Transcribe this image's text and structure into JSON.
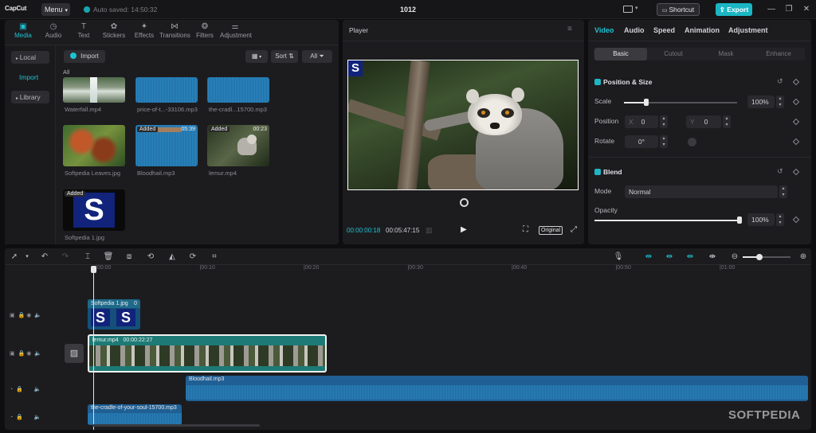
{
  "titlebar": {
    "logo": "CapCut",
    "menu_label": "Menu",
    "autosave": "Auto saved: 14:50:32",
    "project_title": "1012",
    "shortcut_label": "Shortcut",
    "export_label": "Export"
  },
  "media": {
    "tabs": [
      {
        "label": "Media",
        "icon": "media-icon"
      },
      {
        "label": "Audio",
        "icon": "audio-icon"
      },
      {
        "label": "Text",
        "icon": "text-icon"
      },
      {
        "label": "Stickers",
        "icon": "stickers-icon"
      },
      {
        "label": "Effects",
        "icon": "effects-icon"
      },
      {
        "label": "Transitions",
        "icon": "transitions-icon"
      },
      {
        "label": "Filters",
        "icon": "filters-icon"
      },
      {
        "label": "Adjustment",
        "icon": "adjustment-icon"
      }
    ],
    "sidebar": [
      "Local",
      "Import",
      "Library"
    ],
    "import_label": "Import",
    "sort_label": "Sort",
    "all_label": "All",
    "section_all": "All",
    "items": [
      {
        "name": "Waterfall.mp4",
        "badge": "",
        "duration": ""
      },
      {
        "name": "price-of-t...-33106.mp3",
        "badge": "",
        "duration": ""
      },
      {
        "name": "the-cradl...15700.mp3",
        "badge": "",
        "duration": ""
      },
      {
        "name": "Softpedia Leaves.jpg",
        "badge": "",
        "duration": ""
      },
      {
        "name": "Bloodhail.mp3",
        "badge": "Added",
        "duration": "05:39"
      },
      {
        "name": "lemur.mp4",
        "badge": "Added",
        "duration": "00:23"
      },
      {
        "name": "Softpedia 1.jpg",
        "badge": "Added",
        "duration": ""
      }
    ]
  },
  "player": {
    "title": "Player",
    "current_time": "00:00:00:18",
    "total_time": "00:05:47:15",
    "original_label": "Original",
    "logo_letter": "S"
  },
  "props": {
    "tabs": [
      "Video",
      "Audio",
      "Speed",
      "Animation",
      "Adjustment"
    ],
    "subtabs": [
      "Basic",
      "Cutout",
      "Mask",
      "Enhance"
    ],
    "position_size": "Position & Size",
    "scale_label": "Scale",
    "scale_value": "100%",
    "position_label": "Position",
    "pos_x_label": "X",
    "pos_x": "0",
    "pos_y_label": "Y",
    "pos_y": "0",
    "rotate_label": "Rotate",
    "rotate_value": "0°",
    "blend_label": "Blend",
    "mode_label": "Mode",
    "mode_value": "Normal",
    "opacity_label": "Opacity",
    "opacity_value": "100%",
    "scale_fraction": 0.2,
    "opacity_fraction": 1.0
  },
  "timeline": {
    "ticks": [
      "00:00",
      "00:10",
      "00:20",
      "00:30",
      "00:40",
      "00:50",
      "01:00"
    ],
    "clips": {
      "image_clip": "Softpedia 1.jpg",
      "image_clip_dur": "0",
      "video_clip": "lemur.mp4",
      "video_clip_dur": "00:00:22:27",
      "audio_clip1": "Bloodhail.mp3",
      "audio_clip2": "the-cradle-of-your-soul-15700.mp3"
    }
  },
  "watermark": "SOFTPEDIA",
  "colors": {
    "accent": "#1fc2d0",
    "video_clip": "#1d7a76",
    "audio_clip": "#1f5f94"
  }
}
